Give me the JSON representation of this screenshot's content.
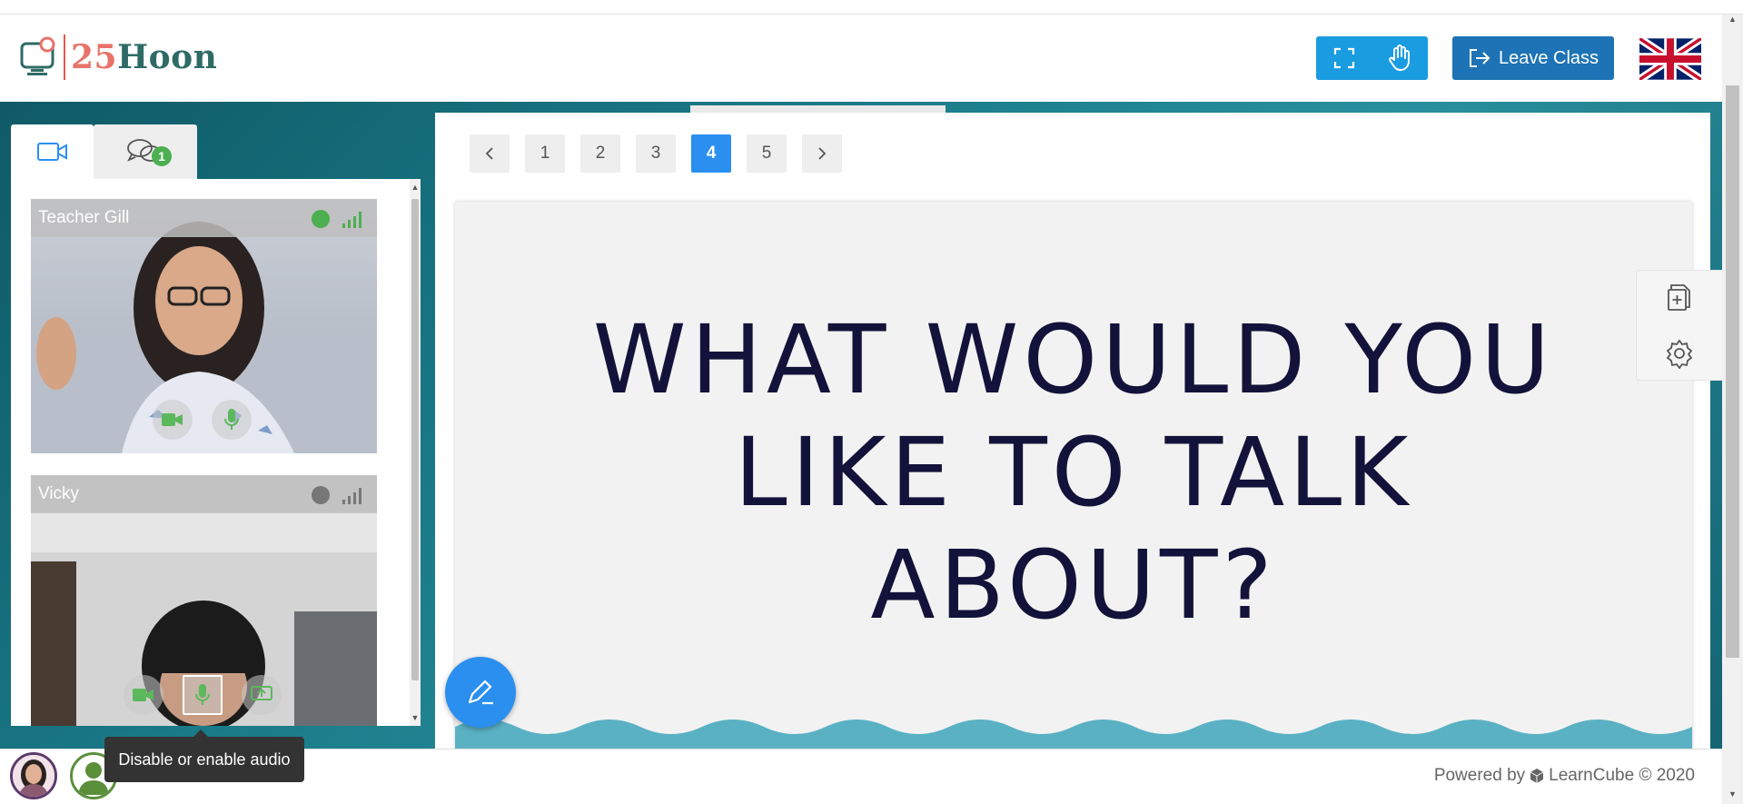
{
  "header": {
    "logo_text_num": "25",
    "logo_text_word": "Hoon",
    "fullscreen_icon": "fullscreen-icon",
    "raise_hand_icon": "hand-icon",
    "leave_label": "Leave Class",
    "language_flag": "uk-flag-icon",
    "accent_color": "#1a9ce0",
    "leave_color": "#1d73b5"
  },
  "sidebar": {
    "tabs": [
      {
        "icon": "video-camera-icon",
        "active": true
      },
      {
        "icon": "chat-bubbles-icon",
        "badge": "1",
        "active": false
      }
    ],
    "participants": [
      {
        "name": "Teacher Gill",
        "status_color": "#4caf50",
        "signal_color": "#4caf50"
      },
      {
        "name": "Vicky",
        "status_color": "#777777",
        "signal_color": "#777777"
      }
    ]
  },
  "pagination": {
    "pages": [
      "1",
      "2",
      "3",
      "4",
      "5"
    ],
    "current": "4",
    "prev_icon": "chevron-left-icon",
    "next_icon": "chevron-right-icon"
  },
  "slide": {
    "title": "WHAT WOULD YOU\nLIKE TO TALK\nABOUT?"
  },
  "tools": {
    "add_page_icon": "add-page-icon",
    "settings_icon": "gear-icon",
    "pen_icon": "pen-icon"
  },
  "tooltip": {
    "text": "Disable or enable audio"
  },
  "footer": {
    "powered_by": "Powered by",
    "brand": "LearnCube © 2020"
  }
}
